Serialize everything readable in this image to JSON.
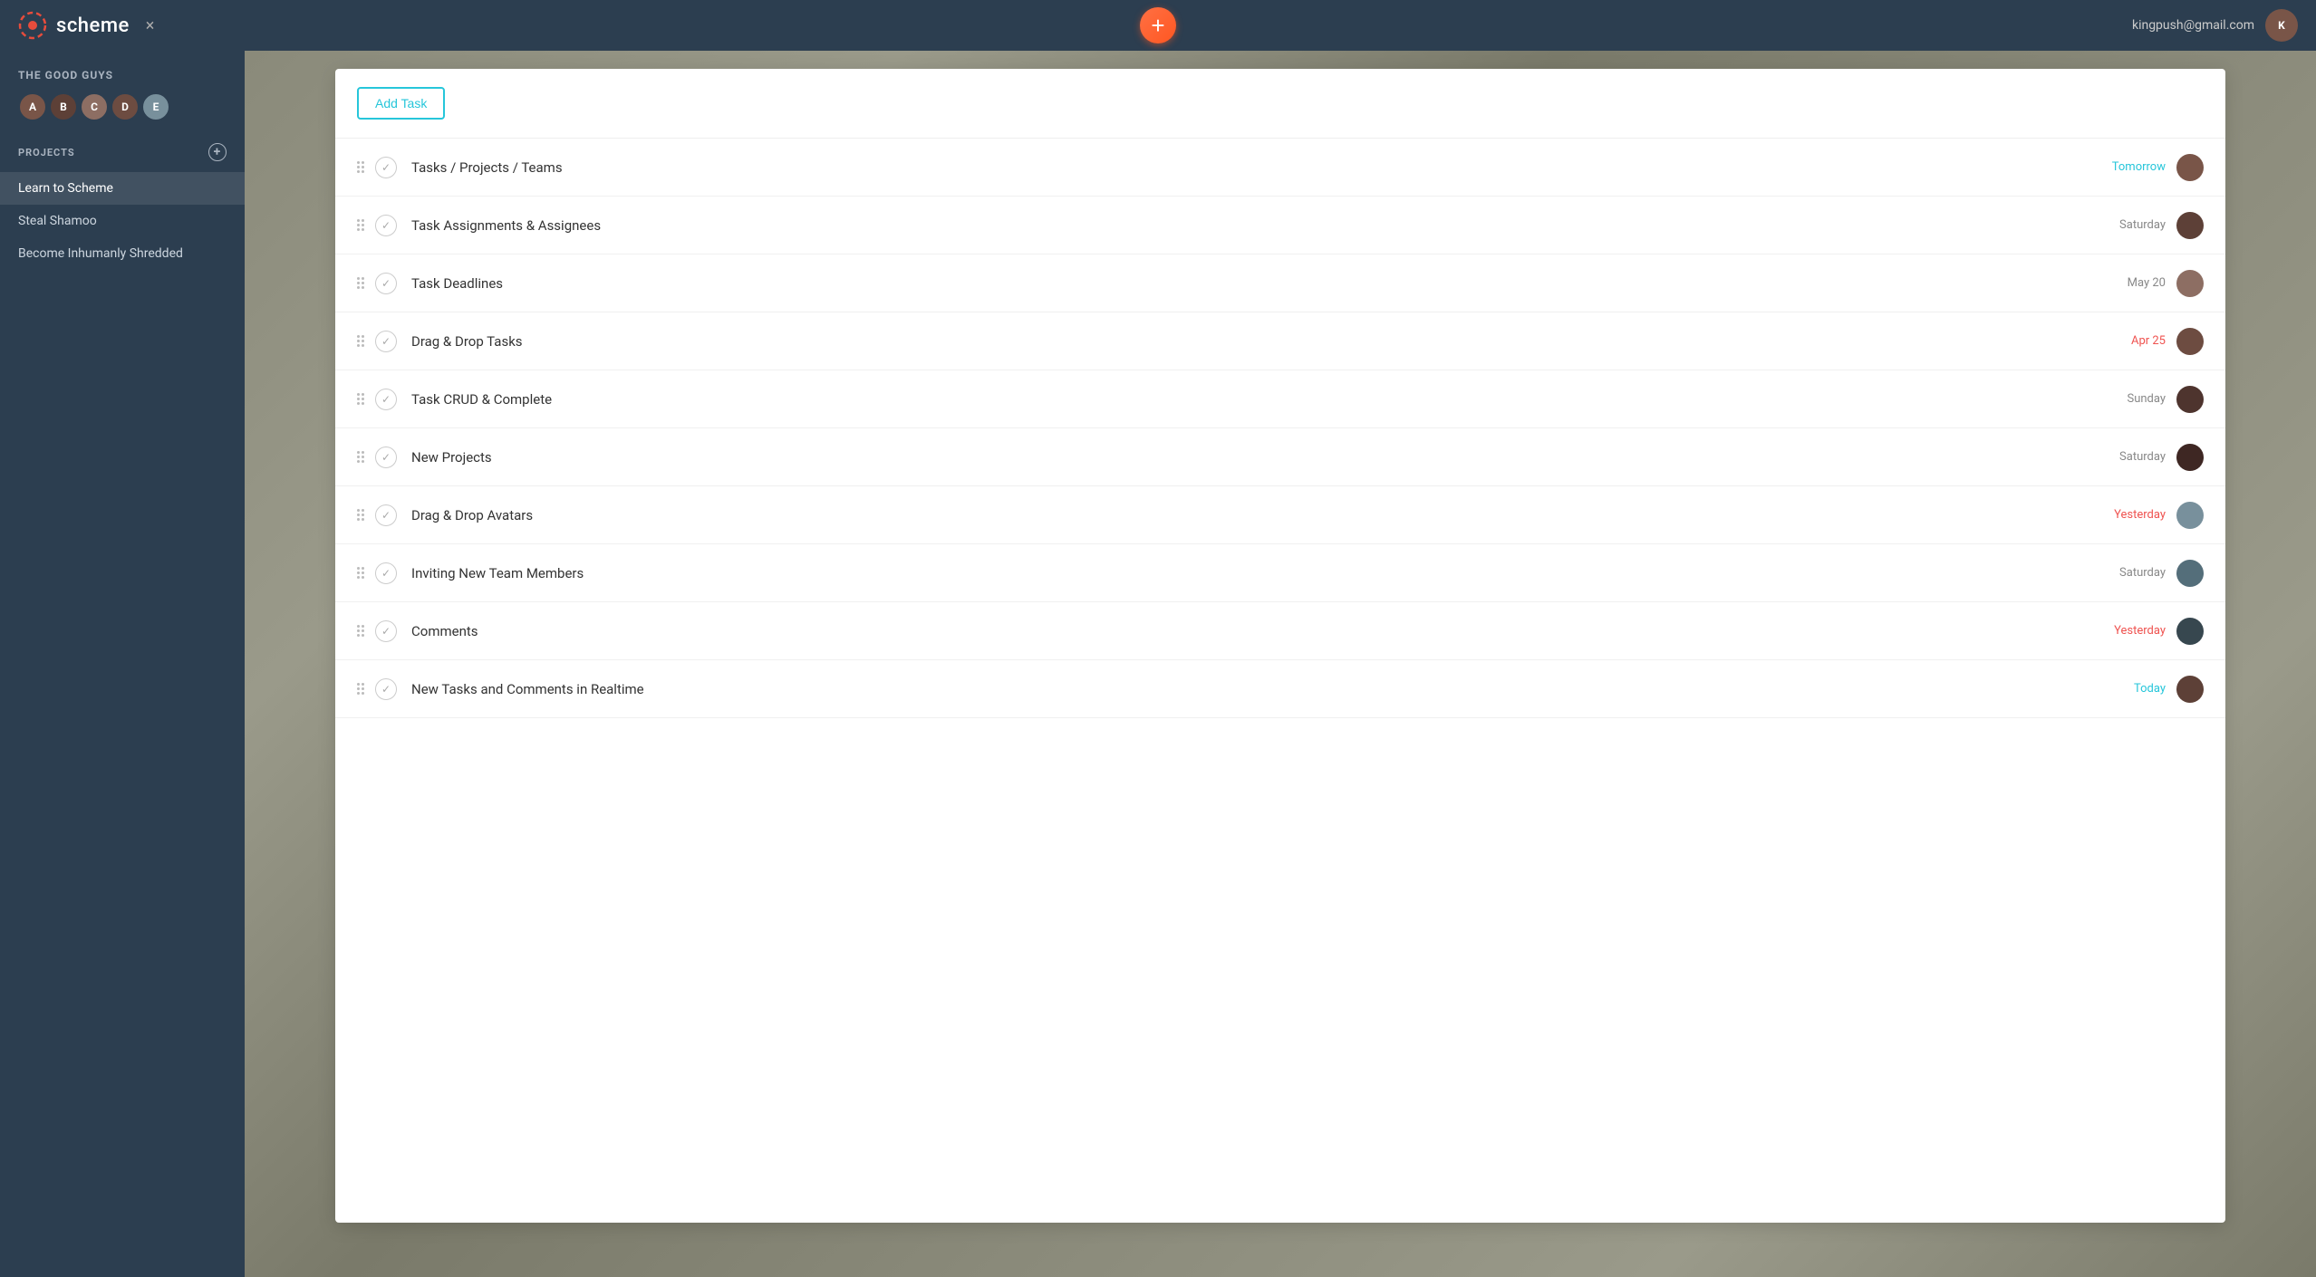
{
  "app": {
    "name": "scheme",
    "close_label": "×"
  },
  "header": {
    "add_btn_label": "+",
    "user_email": "kingpush@gmail.com"
  },
  "sidebar": {
    "team_name": "THE GOOD GUYS",
    "projects_label": "PROJECTS",
    "projects_add_label": "+",
    "items": [
      {
        "label": "Learn to Scheme",
        "active": true
      },
      {
        "label": "Steal Shamoo",
        "active": false
      },
      {
        "label": "Become Inhumanly Shredded",
        "active": false
      }
    ]
  },
  "main": {
    "add_task_label": "Add Task",
    "tasks": [
      {
        "name": "Tasks / Projects / Teams",
        "due": "Tomorrow",
        "due_class": "green",
        "av": "1"
      },
      {
        "name": "Task Assignments & Assignees",
        "due": "Saturday",
        "due_class": "default",
        "av": "2"
      },
      {
        "name": "Task Deadlines",
        "due": "May 20",
        "due_class": "default",
        "av": "3"
      },
      {
        "name": "Drag & Drop Tasks",
        "due": "Apr 25",
        "due_class": "red",
        "av": "4"
      },
      {
        "name": "Task CRUD & Complete",
        "due": "Sunday",
        "due_class": "default",
        "av": "5"
      },
      {
        "name": "New Projects",
        "due": "Saturday",
        "due_class": "default",
        "av": "6"
      },
      {
        "name": "Drag & Drop Avatars",
        "due": "Yesterday",
        "due_class": "red",
        "av": "7"
      },
      {
        "name": "Inviting New Team Members",
        "due": "Saturday",
        "due_class": "default",
        "av": "8"
      },
      {
        "name": "Comments",
        "due": "Yesterday",
        "due_class": "red",
        "av": "9"
      },
      {
        "name": "New Tasks and Comments in Realtime",
        "due": "Today",
        "due_class": "green",
        "av": "2"
      }
    ]
  }
}
